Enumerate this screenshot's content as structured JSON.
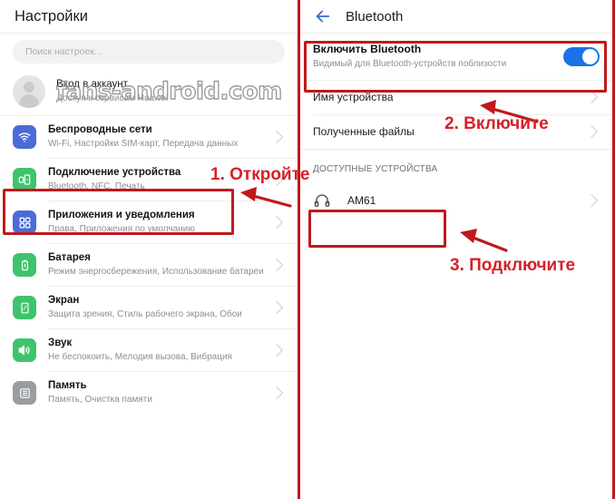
{
  "watermark": "fans-android.com",
  "left_panel": {
    "title": "Настройки",
    "search": {
      "placeholder": "Поиск настроек..."
    },
    "account": {
      "title": "Вход в аккаунт",
      "subtitle": "Доступ к сервисам Huawei"
    },
    "items": [
      {
        "title": "Беспроводные сети",
        "subtitle": "Wi-Fi, Настройки SIM-карт, Передача данных",
        "icon": "wifi-icon",
        "icon_color": "#4a6cd4"
      },
      {
        "title": "Подключение устройства",
        "subtitle": "Bluetooth, NFC, Печать",
        "icon": "device-connection-icon",
        "icon_color": "#3ec46d",
        "highlighted": true
      },
      {
        "title": "Приложения и уведомления",
        "subtitle": "Права, Приложения по умолчанию",
        "icon": "apps-icon",
        "icon_color": "#4a6cd4"
      },
      {
        "title": "Батарея",
        "subtitle": "Режим энергосбережения, Использование батареи",
        "icon": "battery-icon",
        "icon_color": "#3ec46d"
      },
      {
        "title": "Экран",
        "subtitle": "Защита зрения, Стиль рабочего экрана, Обои",
        "icon": "display-icon",
        "icon_color": "#3ec46d"
      },
      {
        "title": "Звук",
        "subtitle": "Не беспокоить, Мелодия вызова, Вибрация",
        "icon": "sound-icon",
        "icon_color": "#3ec46d"
      },
      {
        "title": "Память",
        "subtitle": "Память, Очистка памяти",
        "icon": "storage-icon",
        "icon_color": "#9a9da0"
      }
    ]
  },
  "right_panel": {
    "title": "Bluetooth",
    "back_icon": "back-arrow-icon",
    "toggle": {
      "title": "Включить Bluetooth",
      "subtitle": "Видимый для Bluetooth-устройств поблизости",
      "state": "on",
      "accent_color": "#1a73e8"
    },
    "rows": [
      {
        "label": "Имя устройства"
      },
      {
        "label": "Полученные файлы"
      }
    ],
    "available_section": {
      "header": "ДОСТУПНЫЕ УСТРОЙСТВА",
      "devices": [
        {
          "name": "AM61",
          "icon": "headphones-icon",
          "highlighted": true
        }
      ]
    }
  },
  "annotations": {
    "color": "#d81f26",
    "steps": [
      {
        "text": "1. Откройте"
      },
      {
        "text": "2. Включите"
      },
      {
        "text": "3. Подключите"
      }
    ]
  }
}
